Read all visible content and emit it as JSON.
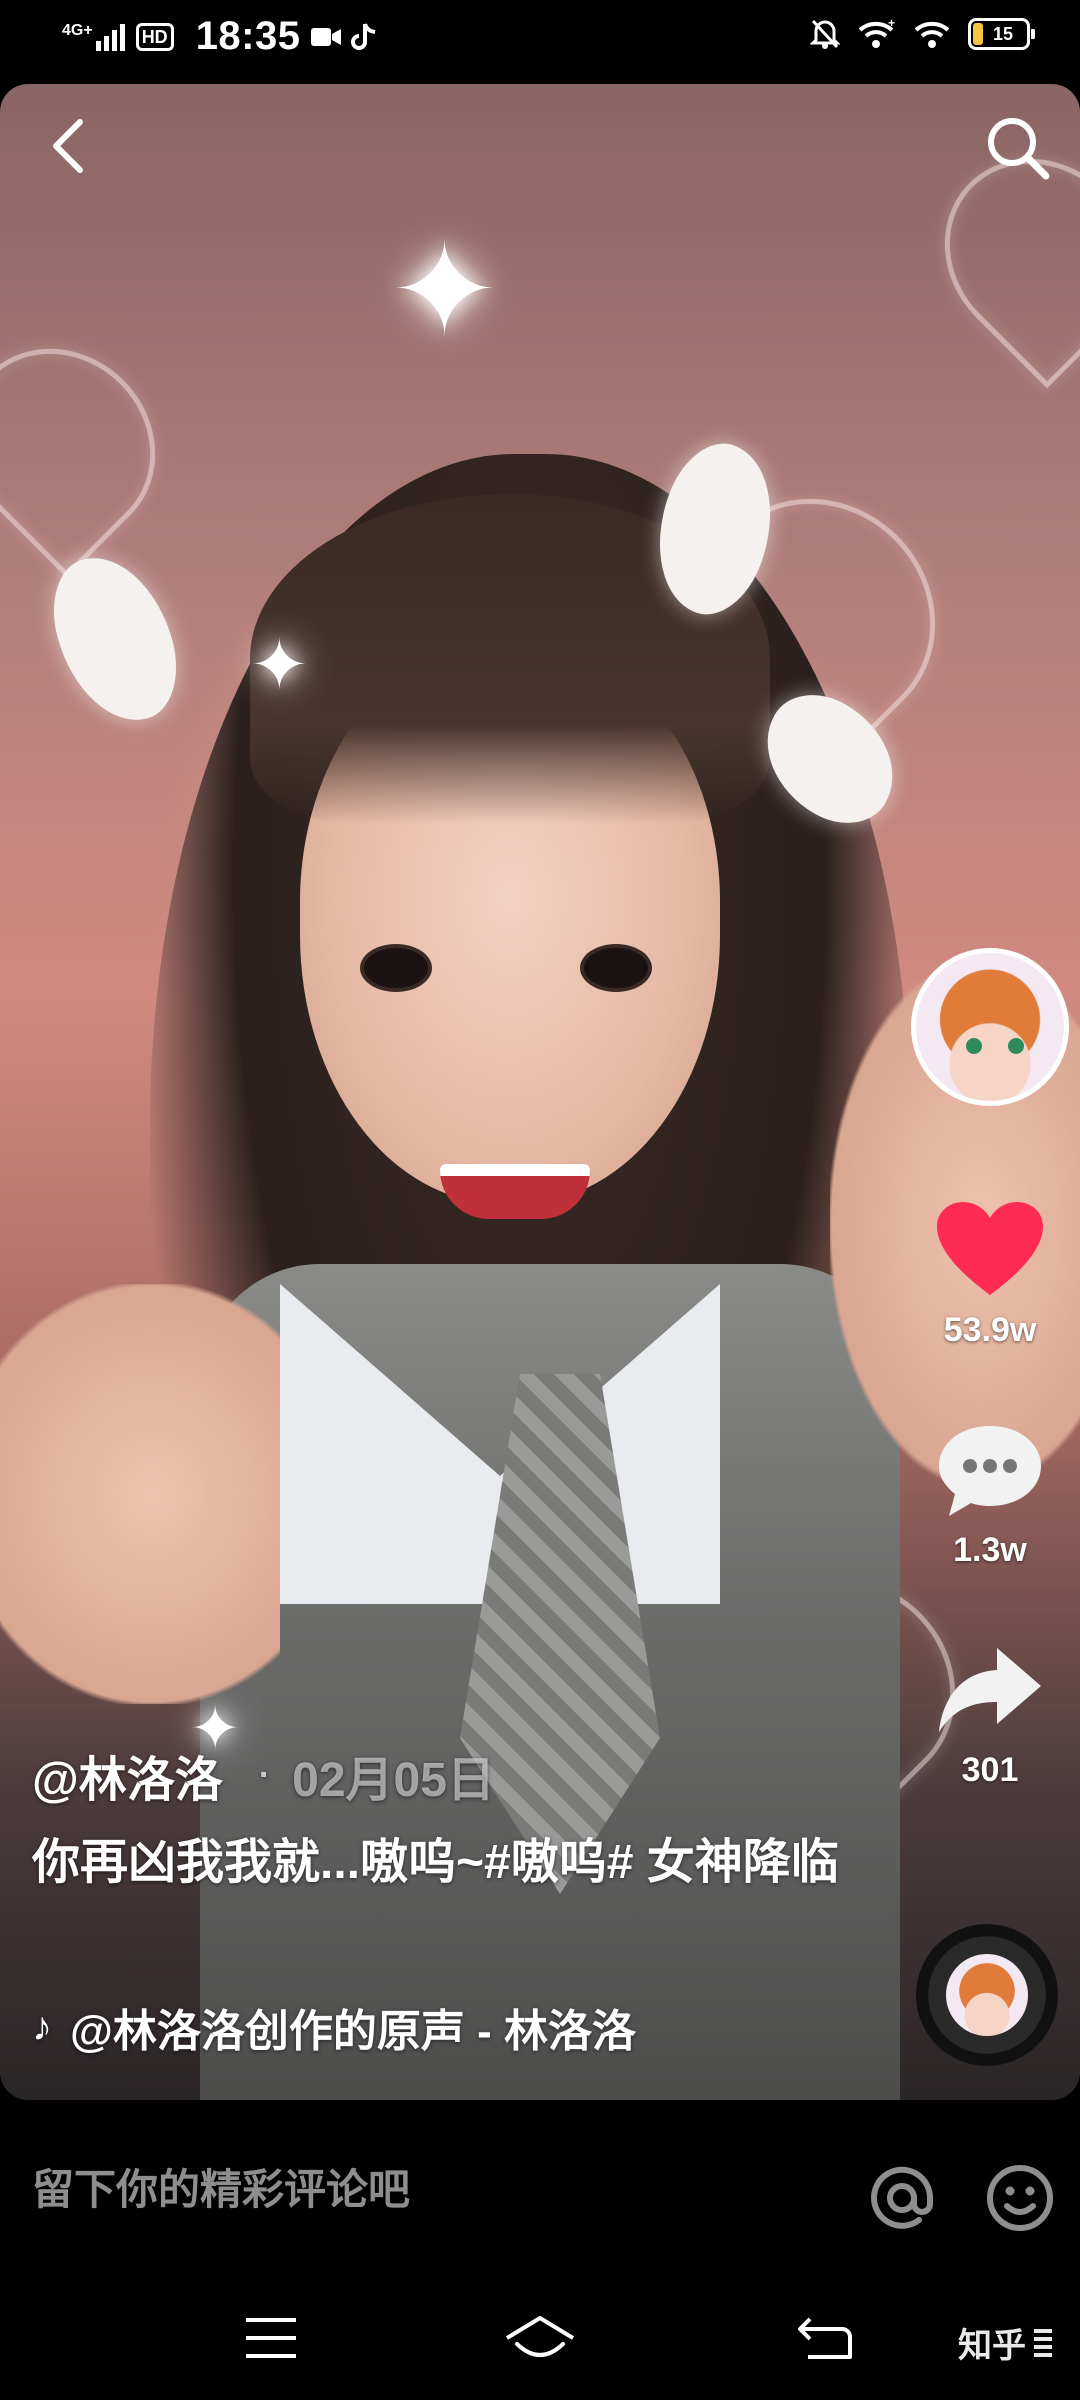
{
  "status_bar": {
    "network": "4G+",
    "hd": "HD",
    "time": "18:35",
    "battery": "15",
    "icons": [
      "signal-icon",
      "hd-icon",
      "video-icon",
      "tiktok-icon",
      "mute-bell-icon",
      "wifi-plus-icon",
      "wifi-icon",
      "battery-icon"
    ]
  },
  "video": {
    "author": "@林洛洛",
    "date": "02月05日",
    "description": "你再凶我我就...嗷呜~#嗷呜# 女神降临",
    "music": "@林洛洛创作的原声 - 林洛洛"
  },
  "actions": {
    "likes": "53.9w",
    "comments": "1.3w",
    "shares": "301",
    "like_color": "#fe2c55"
  },
  "comment_bar": {
    "placeholder": "留下你的精彩评论吧"
  },
  "watermark": {
    "text": "知乎"
  }
}
